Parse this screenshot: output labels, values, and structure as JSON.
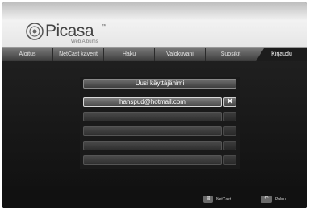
{
  "logo": {
    "text": "Picasa",
    "tm": "™",
    "sub": "Web Albums"
  },
  "tabs": [
    {
      "label": "Aloitus"
    },
    {
      "label": "NetCast kaverit"
    },
    {
      "label": "Haku"
    },
    {
      "label": "Valokuvani"
    },
    {
      "label": "Suosikit"
    },
    {
      "label": "Kirjaudu"
    }
  ],
  "active_tab": "Kirjaudu",
  "login_panel": {
    "title": "Uusi käyttäjänimi",
    "accounts": [
      {
        "value": "hanspud@hotmail.com",
        "delete_label": "✕"
      },
      {
        "value": "",
        "delete_label": ""
      },
      {
        "value": "",
        "delete_label": ""
      },
      {
        "value": "",
        "delete_label": ""
      },
      {
        "value": "",
        "delete_label": ""
      }
    ]
  },
  "footer": {
    "netcast_key": "⊞",
    "netcast_label": "NetCast",
    "back_key": "↶",
    "back_label": "Paluu"
  },
  "colors": {
    "header_bg": "#eeeeee",
    "tab_bar": "#5a5a5a",
    "active_tab": "#1c1c1c",
    "screen_bg": "#1f1f1f"
  }
}
